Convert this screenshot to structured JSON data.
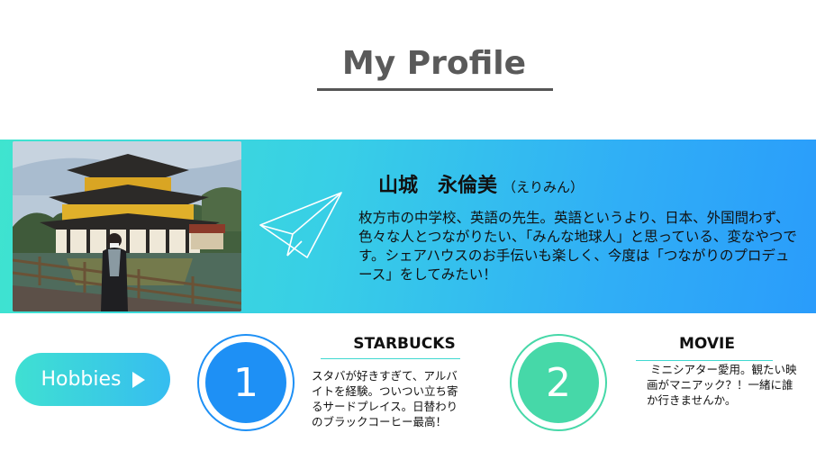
{
  "header": {
    "title": "My Profile"
  },
  "profile": {
    "name": "山城　永倫美",
    "reading": "（えりみん）",
    "bio": "枚方市の中学校、英語の先生。英語というより、日本、外国問わず、色々な人とつながりたい、「みんな地球人」と思っている、変なやつです。シェアハウスのお手伝いも楽しく、今度は「つながりのプロデュース」をしてみたい！"
  },
  "hobbies_button": {
    "label": "Hobbies"
  },
  "hobbies": [
    {
      "number": "1",
      "title": "STARBUCKS",
      "text": "スタバが好きすぎて、アルバイトを経験。ついつい立ち寄るサードプレイス。日替わりのブラックコーヒー最高！",
      "color": "#1e90f5"
    },
    {
      "number": "2",
      "title": "MOVIE",
      "text": "ミニシアター愛用。観たい映画がマニアック？！一緒に誰か行きませんか。",
      "color": "#46d8a8"
    }
  ],
  "colors": {
    "band_start": "#3fe4cf",
    "band_end": "#2a9cfb",
    "title": "#5a5a5a"
  },
  "icons": {
    "plane": "paper-plane-icon",
    "arrow": "play-triangle-icon"
  }
}
